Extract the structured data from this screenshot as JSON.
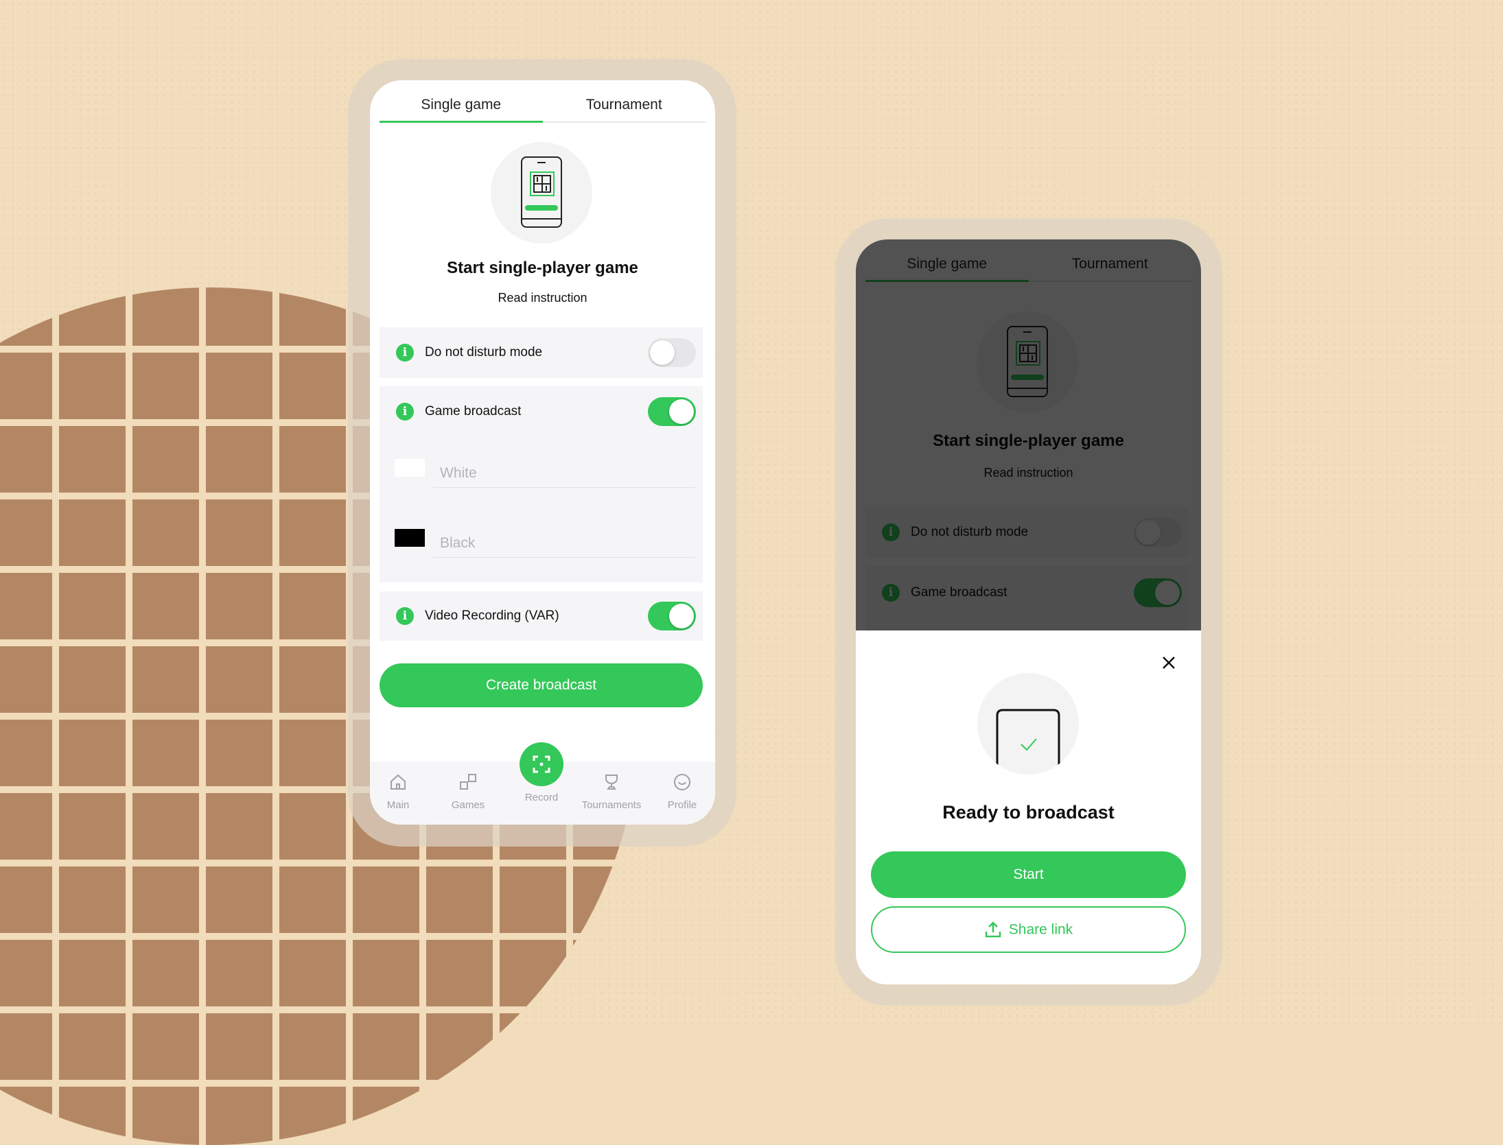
{
  "colors": {
    "accent": "#34c759",
    "background": "#f1dcbb",
    "grid_tile": "#b48764",
    "row_bg": "#f5f5f7"
  },
  "left_phone": {
    "tabs": [
      {
        "label": "Single game",
        "active": true
      },
      {
        "label": "Tournament",
        "active": false
      }
    ],
    "illustration": "phone-chessboard-icon",
    "title": "Start single-player game",
    "instruction_link": "Read instruction",
    "settings": {
      "do_not_disturb": {
        "label": "Do not disturb mode",
        "on": false
      },
      "game_broadcast": {
        "label": "Game broadcast",
        "on": true
      },
      "video_recording": {
        "label": "Video Recording (VAR)",
        "on": true
      }
    },
    "players": {
      "white": {
        "placeholder": "White",
        "value": ""
      },
      "black": {
        "placeholder": "Black",
        "value": ""
      }
    },
    "create_button": "Create broadcast",
    "nav": [
      {
        "label": "Main",
        "icon": "home-icon"
      },
      {
        "label": "Games",
        "icon": "games-icon"
      },
      {
        "label": "Record",
        "icon": "record-icon",
        "active": true
      },
      {
        "label": "Tournaments",
        "icon": "trophy-icon"
      },
      {
        "label": "Profile",
        "icon": "profile-icon"
      }
    ]
  },
  "right_phone": {
    "tabs": [
      {
        "label": "Single game",
        "active": true
      },
      {
        "label": "Tournament",
        "active": false
      }
    ],
    "title": "Start single-player game",
    "instruction_link": "Read instruction",
    "settings": {
      "do_not_disturb": {
        "label": "Do not disturb mode",
        "on": false
      },
      "game_broadcast": {
        "label": "Game broadcast",
        "on": true
      }
    },
    "sheet": {
      "title": "Ready to broadcast",
      "start_button": "Start",
      "share_button": "Share link",
      "close_icon": "close-icon",
      "share_icon": "share-icon"
    }
  }
}
